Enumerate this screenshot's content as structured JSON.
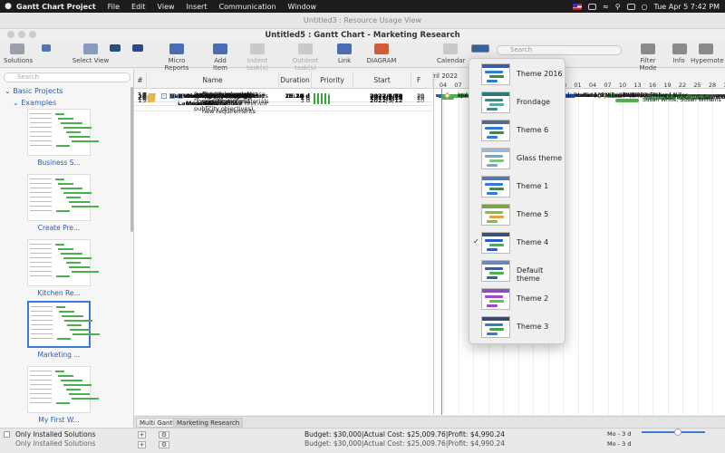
{
  "menubar": {
    "app": "Gantt Chart Project",
    "items": [
      "File",
      "Edit",
      "View",
      "Insert",
      "Communication",
      "Window"
    ],
    "clock": "Tue Apr 5  7:42 PM"
  },
  "window_back_title": "Untitled3 : Resource Usage View",
  "window_title": "Untitled5 : Gantt Chart - Marketing Research",
  "toolbar": {
    "solutions": "Solutions",
    "select_view": "Select View",
    "micro_reports": "Micro Reports",
    "add_item": "Add Item",
    "indent_task": "Indent task(s)",
    "outdent_task": "Outdent task(s)",
    "link": "Link",
    "diagram": "DIAGRAM",
    "calendar": "Calendar",
    "search_placeholder": "Search",
    "filter_mode": "Filter Mode",
    "info": "Info",
    "hypernote": "Hypernote"
  },
  "sidebar": {
    "search_placeholder": "Search",
    "root": "Basic Projects",
    "group": "Examples",
    "thumbs": [
      "Business S...",
      "Create Pre...",
      "Kitchen Re...",
      "Marketing ...",
      "My First W..."
    ],
    "only_installed": "Only Installed Solutions"
  },
  "grid": {
    "headers": {
      "num": "#",
      "name": "Name",
      "duration": "Duration",
      "priority": "Priority",
      "start": "Start",
      "f": "F"
    },
    "rows": [
      {
        "n": "1",
        "name": "New Product Launch",
        "lvl": 0,
        "bold": true,
        "tog": "-",
        "dur": "25.14 d",
        "pri": 4,
        "start": "2022/4/5",
        "f": "20"
      },
      {
        "n": "2",
        "name": "Phase 1 - Planning the Launch",
        "lvl": 1,
        "bold": true,
        "tog": "-",
        "dur": "25.14 d",
        "pri": 4,
        "start": "2022/4/5",
        "f": "20"
      },
      {
        "n": "3",
        "name": "Define the launch group",
        "lvl": 2,
        "bold": false,
        "tog": "",
        "dur": "2 d",
        "pri": 5,
        "start": "2022/4/5",
        "f": "20"
      },
      {
        "n": "4",
        "name": "Define sales goals",
        "lvl": 2,
        "bold": false,
        "tog": "",
        "dur": "2 d",
        "pri": 5,
        "start": "2022/4/7",
        "f": "20"
      },
      {
        "n": "5",
        "name": "Define launch goals (launch timing and publicity objectives)",
        "lvl": 2,
        "bold": false,
        "tog": "",
        "dur": "2 d",
        "pri": 5,
        "start": "2022/4/7",
        "f": "20",
        "tall": true
      },
      {
        "n": "6",
        "name": "Identify partners (if needed)",
        "lvl": 2,
        "bold": true,
        "tog": "-",
        "dur": "10.14 d",
        "pri": 4,
        "start": "2022/4/7",
        "f": "20"
      },
      {
        "n": "7",
        "name": "Identify channel partners",
        "lvl": 3,
        "bold": false,
        "tog": "",
        "dur": "10.14 d",
        "pri": 4,
        "start": "2022/4/7",
        "f": "20"
      },
      {
        "n": "8",
        "name": "Identify retail partners",
        "lvl": 3,
        "bold": false,
        "tog": "",
        "dur": "5 d",
        "pri": 5,
        "start": "2022/4/7",
        "f": "20"
      },
      {
        "n": "9",
        "name": "Identify online opportunities",
        "lvl": 3,
        "bold": false,
        "tog": "",
        "dur": "0 d",
        "pri": 4,
        "start": "2022/4/7",
        "f": "20"
      },
      {
        "n": "10",
        "name": "Define Launch Budget",
        "lvl": 2,
        "bold": true,
        "tog": "-",
        "dur": "13 d",
        "pri": 4,
        "start": "2022/4/21",
        "f": "20"
      },
      {
        "n": "11",
        "name": "Determine budget requirements",
        "lvl": 3,
        "bold": false,
        "tog": "",
        "dur": "7 d",
        "pri": 5,
        "start": "2022/4/21",
        "f": "20"
      },
      {
        "n": "12",
        "name": "Launch budget approval",
        "lvl": 3,
        "bold": false,
        "tog": "",
        "dur": "6 d",
        "pri": 5,
        "start": "2022/5/2",
        "f": "20"
      },
      {
        "n": "13",
        "name": "Planning Complete",
        "lvl": 2,
        "bold": false,
        "tog": "",
        "dur": "0 d",
        "pri": 5,
        "start": "2022/5/10",
        "f": "20"
      },
      {
        "n": "14",
        "name": "Start",
        "lvl": 0,
        "bold": true,
        "tog": "-",
        "dur": "24 d",
        "pri": 4,
        "start": "2022/5/10",
        "f": "20"
      },
      {
        "n": "15",
        "name": "Begin product launch",
        "lvl": 1,
        "bold": false,
        "tog": "",
        "dur": "0 d",
        "pri": 5,
        "start": "2022/5/10",
        "f": "20"
      },
      {
        "n": "16",
        "name": "Marketing",
        "lvl": 1,
        "bold": true,
        "tog": "-",
        "dur": "20 d",
        "pri": 4,
        "start": "2022/5/10",
        "f": "20"
      },
      {
        "n": "17",
        "name": "Determine creative concept",
        "lvl": 2,
        "bold": false,
        "tog": "",
        "dur": "2 d",
        "pri": 5,
        "start": "2022/5/10",
        "f": "20"
      },
      {
        "n": "18",
        "name": "Prepare Marketing Message",
        "lvl": 2,
        "bold": true,
        "tog": "-",
        "dur": "18 d",
        "pri": 4,
        "start": "2022/5/12",
        "f": "20"
      },
      {
        "n": "19",
        "name": "Review current materials and find out new requirements",
        "lvl": 3,
        "bold": false,
        "tog": "",
        "dur": "3 d",
        "pri": 5,
        "start": "2022/5/12",
        "f": "20",
        "xtall": true
      },
      {
        "n": "20",
        "name": "Identify press release requirements",
        "lvl": 3,
        "bold": false,
        "tog": "",
        "dur": "2 d",
        "pri": 5,
        "start": "2022/5/17",
        "f": "20",
        "tall": true
      },
      {
        "n": "21",
        "name": "Determine product specification materials",
        "lvl": 3,
        "bold": false,
        "tog": "",
        "dur": "2 d",
        "pri": 5,
        "start": "2022/5/19",
        "f": "20",
        "tall": true
      },
      {
        "n": "22",
        "name": "Determine sales presentations",
        "lvl": 3,
        "bold": false,
        "tog": "",
        "dur": "2 d",
        "pri": 5,
        "start": "2022/5/26",
        "f": "20",
        "tall": true
      }
    ]
  },
  "timeline": {
    "month": "April 2022",
    "days": [
      "04",
      "07",
      "10",
      "13",
      "16",
      "19",
      "22",
      "25",
      "28",
      "01",
      "04",
      "07",
      "10",
      "13",
      "16",
      "19",
      "22",
      "25",
      "28",
      "31"
    ]
  },
  "chart_labels": {
    "l3": "loore; Clothes [ 1 ]; Paper [ 1 ]; Fund [ 1 ]; Procter & Gamble [ 1 ]",
    "l3a": "Ja",
    "l4": "er & Gamble [ 1 ]; Clothes [ 1 ]",
    "l7": "aren Martin [ 50 %]",
    "l11": "Richard Miller; Paper [ 1 ]",
    "l12": "Richard Miller; Paper [ 1 ]",
    "l13": "2022/5/10; Paper [ 1 ]",
    "l15": "2022/5/10; Richard Miller",
    "l17": "Richard Miller",
    "l19": "Susan White; Susan Williams",
    "l20": "Karen Martin; Susan White",
    "l21": "Susan White",
    "l22": "Richard Miller"
  },
  "theme_menu": {
    "items": [
      {
        "label": "Theme 2016",
        "checked": false,
        "c1": "#2e7bd6",
        "c2": "#3c8d3c",
        "hdr": "#3b5f9e"
      },
      {
        "label": "Frondage",
        "checked": false,
        "c1": "#2f8f8f",
        "c2": "#55a9a9",
        "hdr": "#2a7a7a"
      },
      {
        "label": "Theme 6",
        "checked": false,
        "c1": "#2e7bd6",
        "c2": "#3c8d3c",
        "hdr": "#556b8e"
      },
      {
        "label": "Glass theme",
        "checked": false,
        "c1": "#6fa8dc",
        "c2": "#7bc67b",
        "hdr": "#9fb6cf"
      },
      {
        "label": "Theme 1",
        "checked": false,
        "c1": "#2e7bd6",
        "c2": "#3c8d3c",
        "hdr": "#5a76a8"
      },
      {
        "label": "Theme 5",
        "checked": false,
        "c1": "#8dbb3c",
        "c2": "#e2a43c",
        "hdr": "#7da34a"
      },
      {
        "label": "Theme 4",
        "checked": true,
        "c1": "#2660c7",
        "c2": "#4caf50",
        "hdr": "#3d4f73"
      },
      {
        "label": "Default theme",
        "checked": false,
        "c1": "#2660c7",
        "c2": "#4caf50",
        "hdr": "#6d86b3"
      },
      {
        "label": "Theme 2",
        "checked": false,
        "c1": "#a347c9",
        "c2": "#5bc15b",
        "hdr": "#8a4fb0"
      },
      {
        "label": "Theme 3",
        "checked": false,
        "c1": "#2e7bd6",
        "c2": "#48a348",
        "hdr": "#3a4b6a"
      }
    ]
  },
  "tabs": [
    "Multi Gantt",
    "Marketing Research"
  ],
  "status": {
    "budget": "Budget: $30,000|Actual Cost: $25,009.76|Profit: $4,990.24",
    "zoom": "Mo - 3 d"
  }
}
